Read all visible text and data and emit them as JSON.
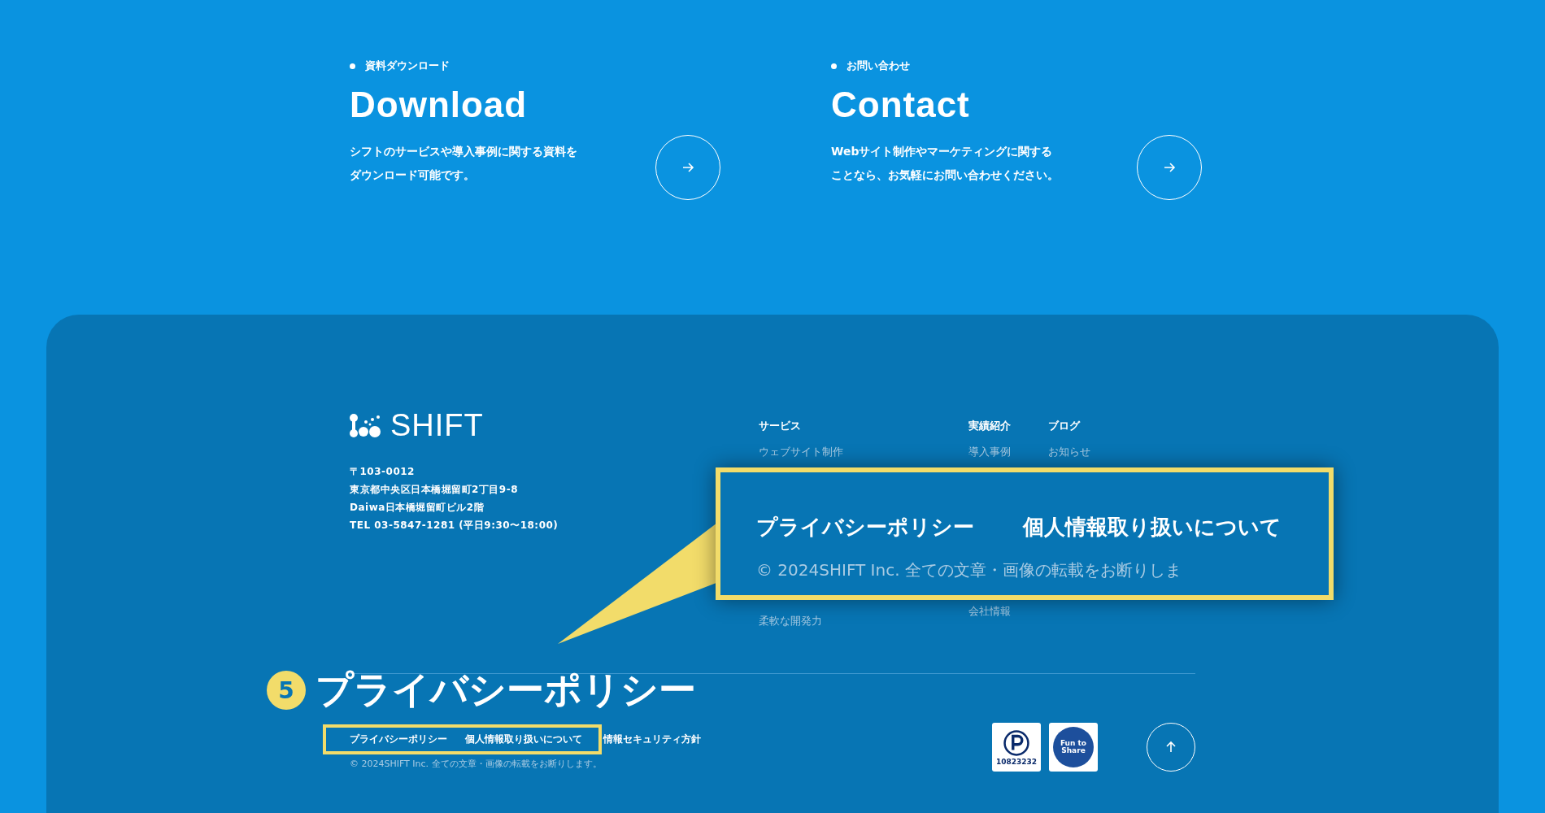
{
  "cta": [
    {
      "eyebrow": "資料ダウンロード",
      "title": "Download",
      "description": "シフトのサービスや導入事例に関する資料をダウンロード可能です。"
    },
    {
      "eyebrow": "お問い合わせ",
      "title": "Contact",
      "description": "Webサイト制作やマーケティングに関することなら、お気軽にお問い合わせください。"
    }
  ],
  "footer": {
    "logo": "SHIFT",
    "address": [
      "〒103-0012",
      "東京都中央区日本橋堀留町2丁目9-8",
      "Daiwa日本橋堀留町ビル2階",
      "TEL 03-5847-1281 (平日9:30〜18:00)"
    ],
    "nav": [
      {
        "heading": "サービス",
        "items": [
          "ウェブサイト制作",
          "柔軟な開発力"
        ]
      },
      {
        "heading": "実績紹介",
        "items": [
          "導入事例",
          "会社情報"
        ]
      },
      {
        "heading": "ブログ",
        "items": [
          "お知らせ"
        ]
      }
    ],
    "legal_links": [
      "プライバシーポリシー",
      "個人情報取り扱いについて",
      "情報セキュリティ方針"
    ],
    "copyright": "© 2024SHIFT Inc. 全ての文章・画像の転載をお断りします。",
    "badges": [
      {
        "kind": "privacy",
        "caption": "10823232"
      },
      {
        "kind": "fun",
        "caption": "Fun to Share"
      }
    ]
  },
  "annotation": {
    "step": "5",
    "title": "プライバシーポリシー",
    "zoom_links": [
      "プライバシーポリシー",
      "個人情報取り扱いについて"
    ],
    "zoom_copyright": "© 2024SHIFT Inc. 全ての文章・画像の転載をお断りしま"
  }
}
